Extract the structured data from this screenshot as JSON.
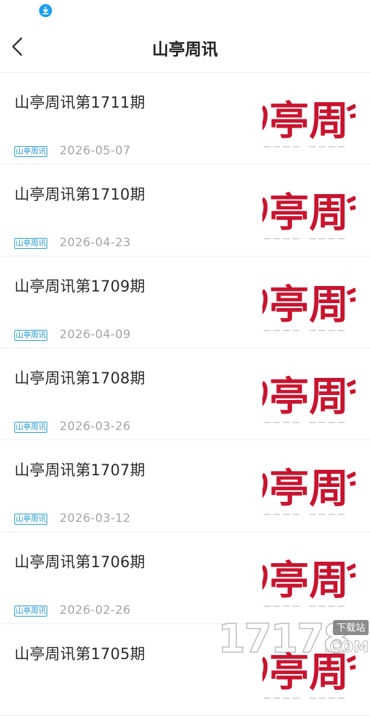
{
  "statusbar": {
    "icon": "download-icon"
  },
  "navbar": {
    "back_icon": "chevron-left-icon",
    "title": "山亭周讯"
  },
  "colors": {
    "accent": "#2496c9",
    "thumb_red": "#c8142f",
    "download_blue": "#1a9ff0"
  },
  "items": [
    {
      "title": "山亭周讯第1711期",
      "tag": "山亭周讯",
      "date": "2026-05-07"
    },
    {
      "title": "山亭周讯第1710期",
      "tag": "山亭周讯",
      "date": "2026-04-23"
    },
    {
      "title": "山亭周讯第1709期",
      "tag": "山亭周讯",
      "date": "2026-04-09"
    },
    {
      "title": "山亭周讯第1708期",
      "tag": "山亭周讯",
      "date": "2026-03-26"
    },
    {
      "title": "山亭周讯第1707期",
      "tag": "山亭周讯",
      "date": "2026-03-12"
    },
    {
      "title": "山亭周讯第1706期",
      "tag": "山亭周讯",
      "date": "2026-02-26"
    },
    {
      "title": "山亭周讯第1705期",
      "tag": "山亭周讯",
      "date": ""
    }
  ],
  "thumbnail": {
    "text": "亭周"
  },
  "watermark": {
    "digits": "17178",
    "badge": "下载站",
    "suffix": ".COM"
  }
}
